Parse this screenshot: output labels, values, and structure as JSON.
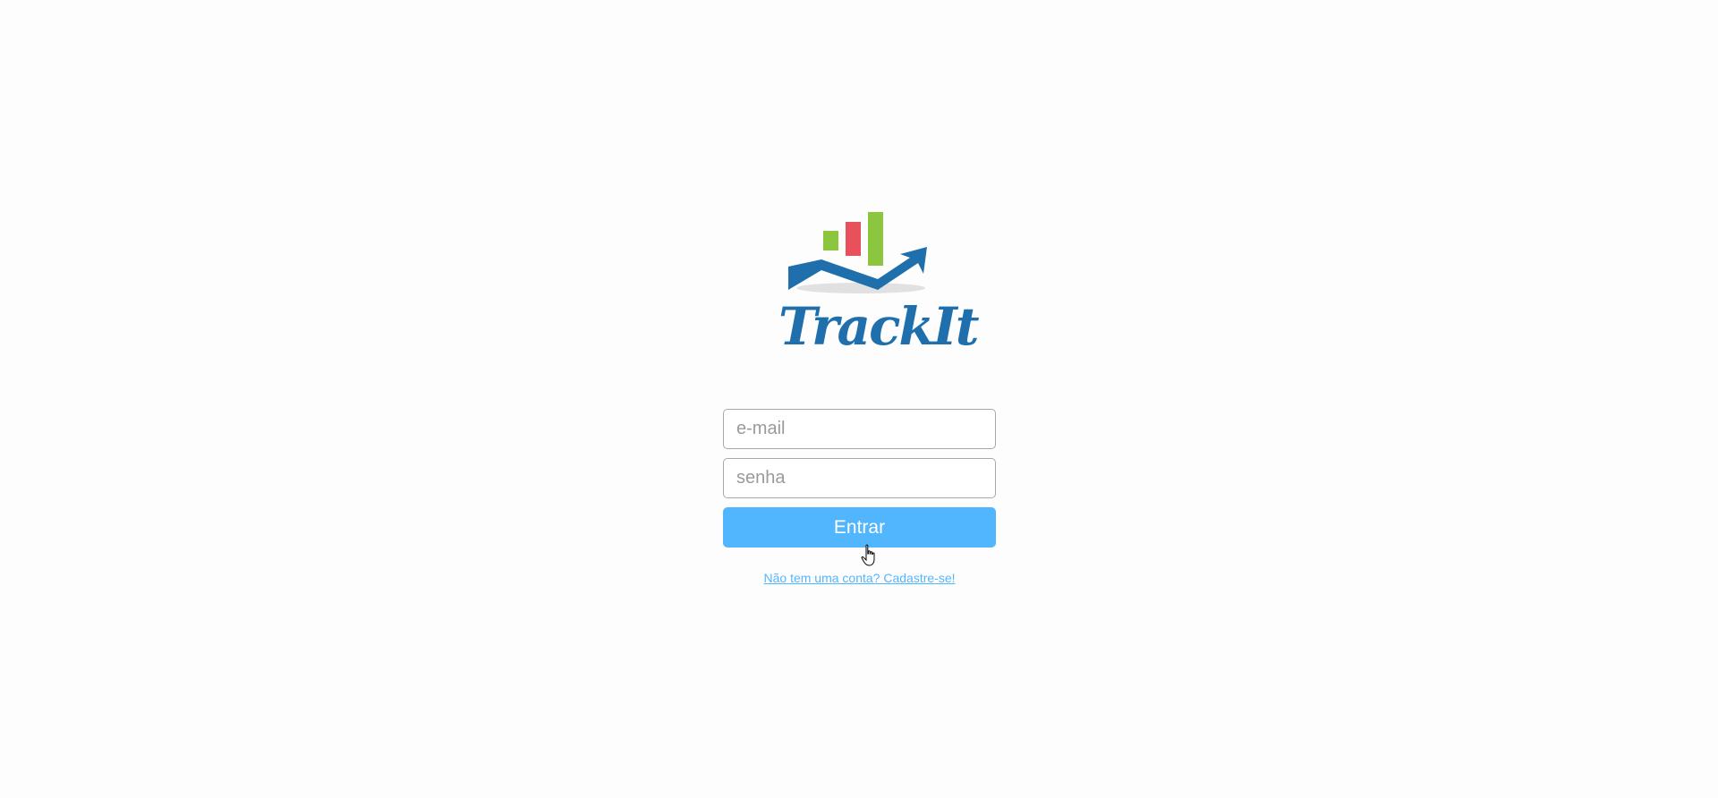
{
  "app": {
    "brand_name": "TrackIt",
    "logo_icon": "bar-chart-arrow-logo"
  },
  "login": {
    "email_placeholder": "e-mail",
    "password_placeholder": "senha",
    "submit_label": "Entrar",
    "signup_link": "Não tem uma conta? Cadastre-se!"
  },
  "colors": {
    "background": "#fdfdfd",
    "brand_blue": "#1e6fab",
    "accent": "#52b6ff",
    "bar_green": "#8cc63e",
    "bar_red": "#e8505b"
  },
  "cursor": {
    "icon": "hand-pointer-icon"
  }
}
